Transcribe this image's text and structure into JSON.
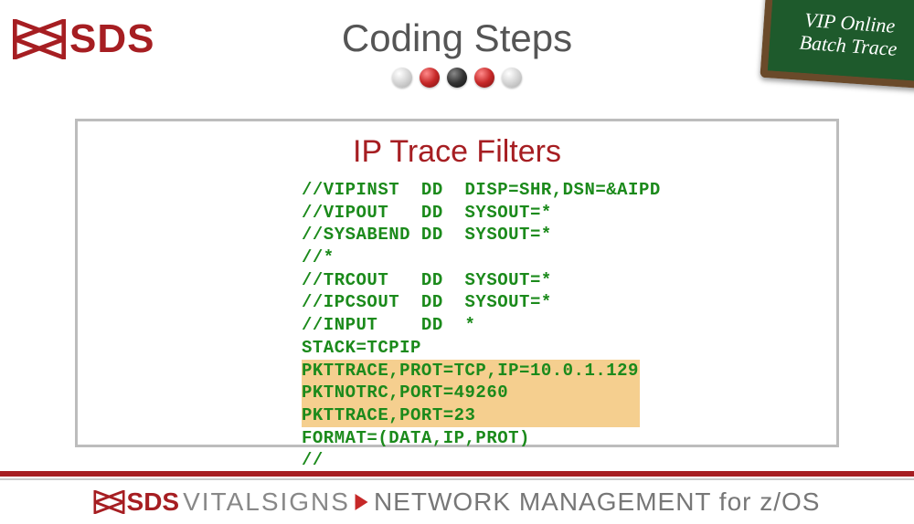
{
  "brand": {
    "name": "SDS"
  },
  "slide": {
    "title": "Coding Steps",
    "chalkboard_line1": "VIP Online",
    "chalkboard_line2": "Batch Trace",
    "section_title": "IP Trace Filters",
    "code_lines": [
      {
        "text": "//VIPINST  DD  DISP=SHR,DSN=&AIPD",
        "hl": false
      },
      {
        "text": "//VIPOUT   DD  SYSOUT=*",
        "hl": false
      },
      {
        "text": "//SYSABEND DD  SYSOUT=*",
        "hl": false
      },
      {
        "text": "//*",
        "hl": false
      },
      {
        "text": "//TRCOUT   DD  SYSOUT=*",
        "hl": false
      },
      {
        "text": "//IPCSOUT  DD  SYSOUT=*",
        "hl": false
      },
      {
        "text": "//INPUT    DD  *",
        "hl": false
      },
      {
        "text": "STACK=TCPIP",
        "hl": false
      },
      {
        "text": "PKTTRACE,PROT=TCP,IP=10.0.1.129",
        "hl": true
      },
      {
        "text": "PKTNOTRC,PORT=49260",
        "hl": true
      },
      {
        "text": "PKTTRACE,PORT=23",
        "hl": true
      },
      {
        "text": "FORMAT=(DATA,IP,PROT)",
        "hl": false
      },
      {
        "text": "//",
        "hl": false
      }
    ]
  },
  "footer": {
    "sds": "SDS",
    "vitalsigns": " VITALSIGNS",
    "rest": " NETWORK MANAGEMENT for z/OS"
  }
}
